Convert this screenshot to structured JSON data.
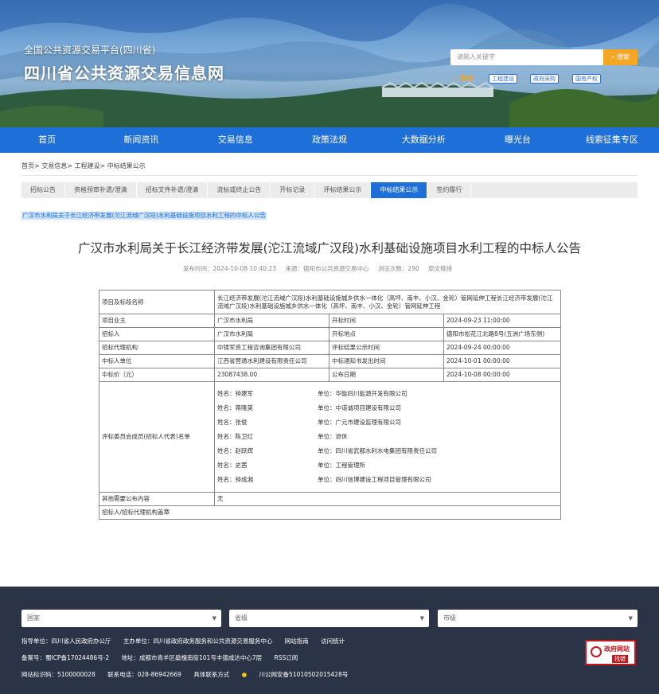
{
  "header": {
    "platform": "全国公共资源交易平台(四川省)",
    "site_title": "四川省公共资源交易信息网",
    "search_placeholder": "请输入关键字",
    "search_button": "搜索",
    "hot_label": "热搜:",
    "hot_tags": [
      "工程建设",
      "政府采购",
      "国有产权"
    ]
  },
  "nav": [
    "首页",
    "新闻资讯",
    "交易信息",
    "政策法规",
    "大数据分析",
    "曝光台",
    "线索征集专区"
  ],
  "breadcrumb": "首页> 交易信息> 工程建设> 中标结果公示",
  "tabs": [
    "招标公告",
    "资格预审补遗/澄清",
    "招标文件补遗/澄清",
    "流标或终止公告",
    "开标记录",
    "评标结果公示",
    "中标结果公示",
    "签约履行"
  ],
  "active_tab": "中标结果公示",
  "notice_link": "广汉市水利局关于长江经济带发展(沱江流域广汉段)水利基础设施项目水利工程的中标人公告",
  "article": {
    "title": "广汉市水利局关于长江经济带发展(沱江流域广汉段)水利基础设施项目水利工程的中标人公告",
    "publish_time": "发布时间：2024-10-08 10:40:23",
    "source": "来源：德阳市公共资源交易中心",
    "views": "浏览次数：290",
    "original_link": "原文链接"
  },
  "table": {
    "project_label": "项目及标段名称",
    "project_value": "长江经济带发展(沱江流域广汉段)水利基础设施城乡供水一体化（高坪、南丰、小汉、金轮）管网延伸工程长江经济带发展(沱江流域广汉段)水利基础设施城乡供水一体化（高坪、南丰、小汉、金轮）管网延伸工程",
    "rows": [
      {
        "l1": "项目业主",
        "v1": "广汉市水利局",
        "l2": "开标时间",
        "v2": "2024-09-23 11:00:00"
      },
      {
        "l1": "招标人",
        "v1": "广汉市水利局",
        "l2": "开标地点",
        "v2": "德阳市松花江北路8号(五洲广场东侧)"
      },
      {
        "l1": "招标代理机构",
        "v1": "中锦军资工程咨询集团有限公司",
        "l2": "评标结果公示时间",
        "v2": "2024-09-24 00:00:00"
      },
      {
        "l1": "中标人单位",
        "v1": "江西省营通水利建设有限责任公司",
        "l2": "中标通知书发出时间",
        "v2": "2024-10-01 00:00:00"
      },
      {
        "l1": "中标价（元）",
        "v1": "23087438.00",
        "l2": "公布日期",
        "v2": "2024-10-08 00:00:00"
      }
    ],
    "committee_label": "评标委员会成员(招标人代表)名单",
    "committee": [
      {
        "name": "姓名：钟建军",
        "unit": "单位：华能四川能源开发有限公司"
      },
      {
        "name": "姓名：蒋隆英",
        "unit": "单位：中道诚项目建设有限公司"
      },
      {
        "name": "姓名：张俊",
        "unit": "单位：广元市建设监理有限公司"
      },
      {
        "name": "姓名：陈卫红",
        "unit": "单位：退休"
      },
      {
        "name": "姓名：赵跃辉",
        "unit": "单位：四川省武都水利水电集团有限责任公司"
      },
      {
        "name": "姓名：史茜",
        "unit": "单位：工程管理所"
      },
      {
        "name": "姓名：钟成湘",
        "unit": "单位：四川信博建设工程项目管理有限公司"
      }
    ],
    "other_label": "其他需要公布内容",
    "other_value": "无",
    "seal_label": "招标人/招标代理机构盖章"
  },
  "footer": {
    "selects": [
      "国家",
      "省级",
      "市级"
    ],
    "line1": [
      "指导单位：四川省人民政府办公厅",
      "主办单位：四川省政府政务服务和公共资源交易服务中心",
      "网站指南",
      "访问统计"
    ],
    "line2": [
      "备案号：蜀ICP备17024486号-2",
      "地址：成都市青羊区燊槐南街101号丰德成达中心7层",
      "RSS订阅"
    ],
    "line3": [
      "网站标识码：5100000028",
      "联系电话：028-86942669",
      "具体联系方式",
      "川公网安备51010502015428号"
    ],
    "badge_top": "政府网站",
    "badge_bottom": "找错"
  }
}
